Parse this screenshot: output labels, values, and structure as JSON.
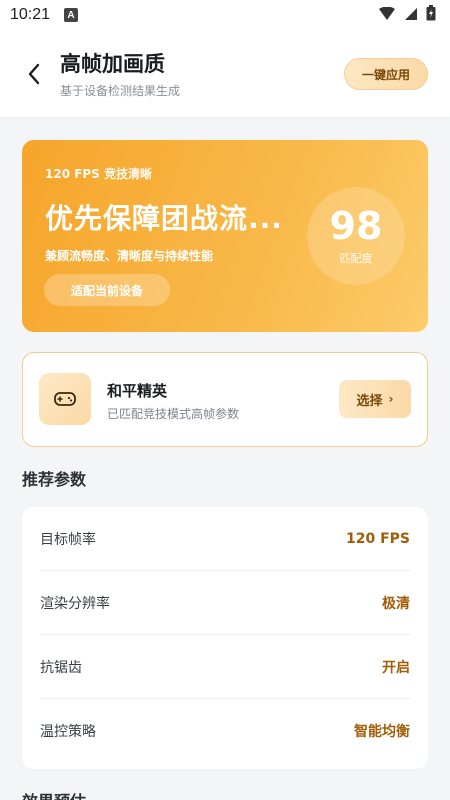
{
  "status_bar": {
    "time": "10:21",
    "notif_icon_letter": "A",
    "icons": [
      "wifi-icon",
      "signal-icon",
      "battery-icon"
    ]
  },
  "header": {
    "title": "高帧加画质",
    "subtitle": "基于设备检测结果生成",
    "apply_label": "一键应用"
  },
  "hero": {
    "tag": "120 FPS 竞技清晰",
    "title": "优先保障团战流...",
    "desc": "兼顾流畅度、清晰度与持续性能",
    "button_label": "适配当前设备",
    "score": "98",
    "score_label": "匹配度"
  },
  "game": {
    "icon": "gamepad-icon",
    "name": "和平精英",
    "desc": "已匹配竞技模式高帧参数",
    "select_label": "选择",
    "select_chevron": "›"
  },
  "params": {
    "section_title": "推荐参数",
    "rows": [
      {
        "key": "目标帧率",
        "value": "120 FPS"
      },
      {
        "key": "渲染分辨率",
        "value": "极清"
      },
      {
        "key": "抗锯齿",
        "value": "开启"
      },
      {
        "key": "温控策略",
        "value": "智能均衡"
      }
    ]
  },
  "next_section": {
    "title": "效果预估"
  },
  "colors": {
    "accent": "#f6a52a",
    "accent_text": "#a25d07",
    "background": "#f4f5f7"
  }
}
